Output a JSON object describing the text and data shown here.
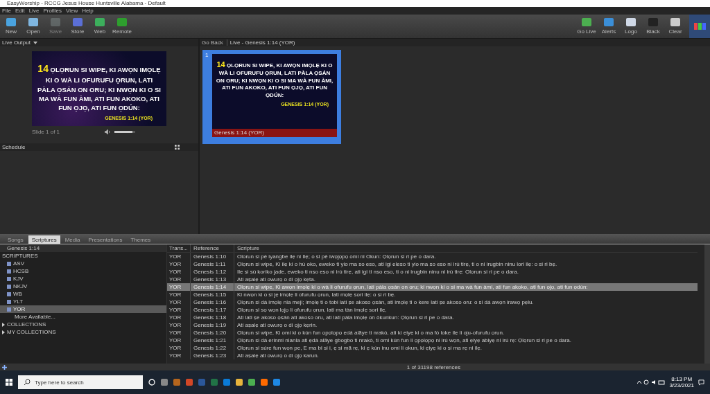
{
  "window": {
    "title": "EasyWorship - RCCG Jesus House Huntsville Alabama - Default"
  },
  "menu": [
    "File",
    "Edit",
    "Live",
    "Profiles",
    "View",
    "Help"
  ],
  "toolbar_left": [
    {
      "label": "New",
      "disabled": false
    },
    {
      "label": "Open",
      "disabled": false
    },
    {
      "label": "Save",
      "disabled": true
    },
    {
      "label": "Store",
      "disabled": false
    },
    {
      "label": "Web",
      "disabled": false
    },
    {
      "label": "Remote",
      "disabled": false
    }
  ],
  "toolbar_right": [
    {
      "label": "Go Live"
    },
    {
      "label": "Alerts"
    },
    {
      "label": "Logo"
    },
    {
      "label": "Black"
    },
    {
      "label": "Clear"
    }
  ],
  "live_output": {
    "title": "Live Output",
    "verse_number": "14",
    "verse_text": "ỌLỌRUN SI WIPE, KI AWỌN IMỌLẸ KI O WÀ LI OFURUFU ỌRUN, LATI PÀLA ỌSÁN ON ORU; KI NWỌN KI O SI MA WÀ FUN ÀMI, ATI FUN AKOKO, ATI FUN ỌJỌ, ATI FUN ỌDÚN:",
    "reference": "GENESIS 1:14 (YOR)",
    "slide_counter": "Slide 1 of 1",
    "volume": {
      "level": 0.85
    }
  },
  "live_panel": {
    "go_back": "Go Back",
    "title": "Live - Genesis 1:14 (YOR)",
    "slides": [
      {
        "number": "1",
        "verse_number": "14",
        "verse_text": "ỌLỌRUN SI WIPE, KI AWỌN IMỌLẸ KI O WÀ LI OFURUFU ỌRUN, LATI PÀLA ỌSÁN ON ORU; KI NWỌN KI O SI MA WÀ FUN ÀMI, ATI FUN AKOKO, ATI FUN ỌJỌ, ATI FUN ỌDÚN:",
        "reference": "GENESIS 1:14 (YOR)",
        "caption": "Genesis 1:14 (YOR)",
        "selected": true
      }
    ]
  },
  "schedule": {
    "title": "Schedule"
  },
  "tabs": [
    {
      "label": "Songs",
      "selected": false
    },
    {
      "label": "Scriptures",
      "selected": true
    },
    {
      "label": "Media",
      "selected": false
    },
    {
      "label": "Presentations",
      "selected": false
    },
    {
      "label": "Themes",
      "selected": false
    }
  ],
  "search": {
    "value": "Genesis 1:14"
  },
  "sidebar": {
    "items": [
      {
        "label": "SCRIPTURES",
        "expanded": true,
        "children": [
          {
            "label": "ASV",
            "selected": false
          },
          {
            "label": "HCSB",
            "selected": false
          },
          {
            "label": "KJV",
            "selected": false
          },
          {
            "label": "NKJV",
            "selected": false
          },
          {
            "label": "WB",
            "selected": false
          },
          {
            "label": "YLT",
            "selected": false
          },
          {
            "label": "YOR",
            "selected": true
          }
        ],
        "more": "More Available..."
      },
      {
        "label": "COLLECTIONS",
        "expanded": false
      },
      {
        "label": "MY COLLECTIONS",
        "expanded": false
      }
    ]
  },
  "table": {
    "columns": [
      "Trans...",
      "Reference",
      "Scripture"
    ],
    "rows": [
      {
        "translation": "YOR",
        "reference": "Genesis 1:10",
        "scripture": "Olorun si pè iyangbe ilẹ ni Ilẹ; o si pè iwọjọpọ omi ni Okun: Ọlọrun si ri pe o dara.",
        "selected": false
      },
      {
        "translation": "YOR",
        "reference": "Genesis 1:11",
        "scripture": "Ọlọrun si wipe, Ki ilẹ ki o hù oko, eweko ti yio ma so eso, ati igi eleso ti yio ma so eso ni irú tirẹ, ti o ni irugbin ninu lori ilẹ: o si ri bẹ.",
        "selected": false
      },
      {
        "translation": "YOR",
        "reference": "Genesis 1:12",
        "scripture": "Ilẹ si sù koriko jade, eweko ti nso eso ni irú tirẹ, ati igi ti nso eso, ti o ni irugbin ninu ni irú tirẹ: Ọlọrun si ri pe o dara.",
        "selected": false
      },
      {
        "translation": "YOR",
        "reference": "Genesis 1:13",
        "scripture": "Ati aṣalẹ ati owurọ o di ọjọ kẹta.",
        "selected": false
      },
      {
        "translation": "YOR",
        "reference": "Genesis 1:14",
        "scripture": "Ọlọrun si wipe, Ki awọn imọlẹ ki o wà li ofurufu ọrun, lati pàla ọsán on oru; ki nwọn ki o si ma wà fun àmi, ati fun akoko, ati fun ọjọ, ati fun ọdún:",
        "selected": true
      },
      {
        "translation": "YOR",
        "reference": "Genesis 1:15",
        "scripture": "Ki nwọn ki o si jẹ imọlẹ li ofurufu ọrun, lati mọlẹ sori ilẹ: o si ri bẹ.",
        "selected": false
      },
      {
        "translation": "YOR",
        "reference": "Genesis 1:16",
        "scripture": "Ọlọrun si dá imọlẹ nla meji; imọlẹ ti o tobi lati ṣe akoso ọsán, ati imọlẹ ti o kere lati ṣe akoso oru: o si dá awọn irawọ pẹlu.",
        "selected": false
      },
      {
        "translation": "YOR",
        "reference": "Genesis 1:17",
        "scripture": "Ọlọrun si sọ wọn lọjọ li ofurufu ọrun, lati ma tàn imọlẹ sori ilẹ,",
        "selected": false
      },
      {
        "translation": "YOR",
        "reference": "Genesis 1:18",
        "scripture": "Ati lati ṣe akoso ọsán ati akoso oru, ati lati pàla imọlẹ on òkunkun: Ọlọrun si ri pe o dara.",
        "selected": false
      },
      {
        "translation": "YOR",
        "reference": "Genesis 1:19",
        "scripture": "Ati aṣalẹ ati owurọ o di ọjọ kẹrin.",
        "selected": false
      },
      {
        "translation": "YOR",
        "reference": "Genesis 1:20",
        "scripture": "Ọlọrun si wipe, Ki omi ki o kún fun ọpọlọpọ ẹdá alãye ti nrakò, ati ki ẹiyẹ ki o ma fò loke ilẹ li oju-ofurufu ọrun.",
        "selected": false
      },
      {
        "translation": "YOR",
        "reference": "Genesis 1:21",
        "scripture": "Ọlọrun si dá erinmi nlanla ati ẹdá alãye gbogbo ti nrakò, ti omi kún fun li ọpọlọpọ ni irú wọn, ati ẹiyẹ abiyẹ ni irú rẹ: Ọlọrun si ri pe o dara.",
        "selected": false
      },
      {
        "translation": "YOR",
        "reference": "Genesis 1:22",
        "scripture": "Ọlọrun si súre fun wọn pe, E ma bi si i, ẹ si mã rẹ, ki ẹ kún inu omi li okun, ki ẹiyẹ ki o si ma rẹ ni ilẹ.",
        "selected": false
      },
      {
        "translation": "YOR",
        "reference": "Genesis 1:23",
        "scripture": "Ati aṣalẹ ati owurọ o di ọjọ karun.",
        "selected": false
      }
    ]
  },
  "status_bar": {
    "count": "1 of 31198 references"
  },
  "taskbar": {
    "search_placeholder": "Type here to search",
    "time": "8:13 PM",
    "date": "3/23/2021"
  }
}
